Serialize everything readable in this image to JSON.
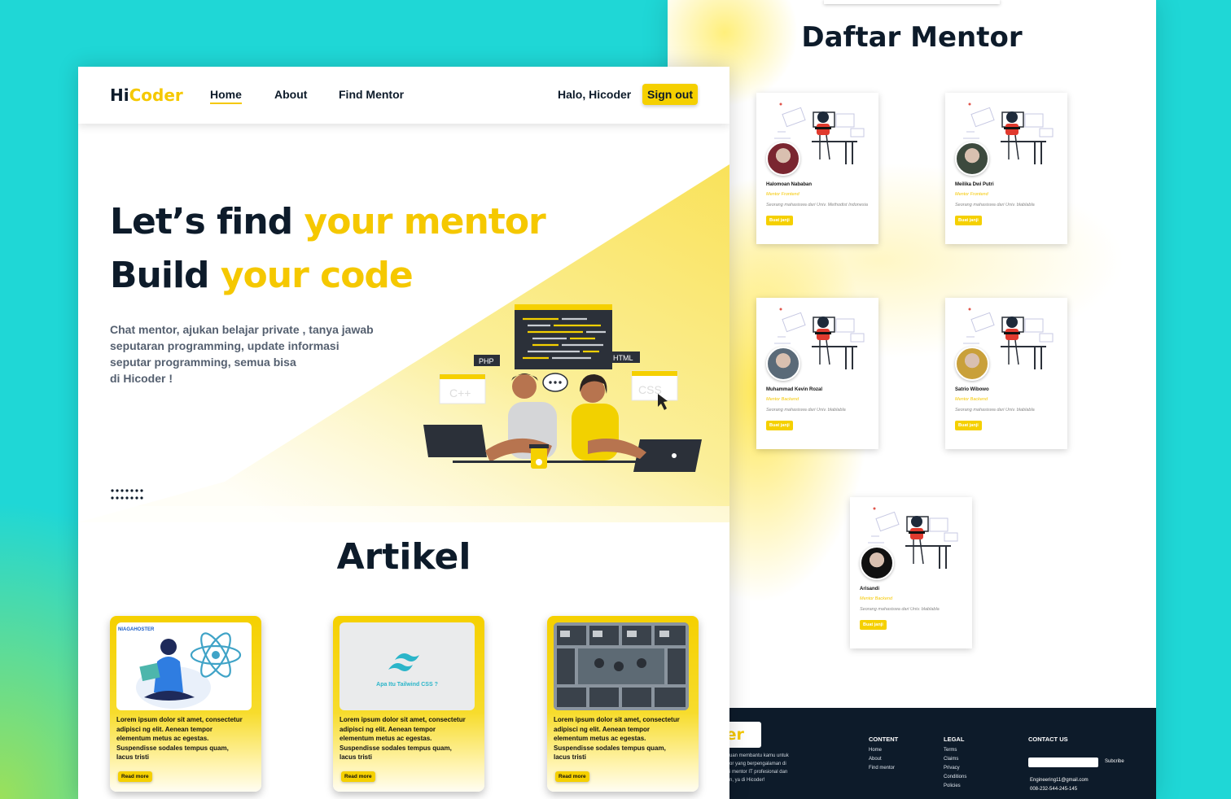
{
  "nav": {
    "logo_part1": "Hi",
    "logo_part2": "Coder",
    "links": [
      "Home",
      "About",
      "Find Mentor"
    ],
    "greeting": "Halo, Hicoder",
    "signout": "Sign out"
  },
  "hero": {
    "line1_dark": "Let’s find",
    "line1_yellow": "your mentor",
    "line2_dark": "Build",
    "line2_yellow": "your code",
    "lead": [
      "Chat mentor, ajukan belajar private , tanya jawab",
      "seputaran programming, update informasi",
      "seputar programming, semua bisa",
      "di Hicoder !"
    ],
    "illustration_tags": [
      "PHP",
      "HTML",
      "C++",
      "CSS"
    ]
  },
  "artikel": {
    "title": "Artikel",
    "cards": [
      {
        "text": [
          "Lorem ipsum dolor sit amet, consectetur",
          "adipisci ng elit. Aenean tempor",
          "elementum metus ac egestas.",
          "Suspendisse sodales tempus quam,",
          " lacus tristi"
        ],
        "button": "Read more",
        "image_caption": "NIAGAHOSTER"
      },
      {
        "text": [
          "Lorem ipsum dolor sit amet, consectetur",
          "adipisci ng elit. Aenean tempor",
          "elementum metus ac egestas.",
          "Suspendisse sodales tempus quam,",
          " lacus tristi"
        ],
        "button": "Read more",
        "image_caption": "Apa Itu Tailwind CSS ?"
      },
      {
        "text": [
          "Lorem ipsum dolor sit amet, consectetur",
          "adipisci ng elit. Aenean tempor",
          "elementum metus ac egestas.",
          "Suspendisse sodales tempus quam,",
          " lacus tristi"
        ],
        "button": "Read more",
        "image_caption": ""
      }
    ]
  },
  "mentors": {
    "title": "Daftar Mentor",
    "list": [
      {
        "name": "Halomoan Nababan",
        "role": "Mentor Frontend",
        "desc": "Seorang mahasiswa dari Univ. Methodist Indonesia",
        "button": "Buat janji"
      },
      {
        "name": "Meilika Dwi Putri",
        "role": "Mentor Frontend",
        "desc": "Seorang mahasiswa dari Univ. blablabla",
        "button": "Buat janji"
      },
      {
        "name": "Muhammad Kevin Rozal",
        "role": "Mentor Backend",
        "desc": "Seorang mahasiswa dari Univ. blablabla",
        "button": "Buat janji"
      },
      {
        "name": "Satrio Wibowo",
        "role": "Mentor Backend",
        "desc": "Seorang mahasiswa dari Univ. blablabla",
        "button": "Buat janji"
      },
      {
        "name": "Arisandi",
        "role": "Mentor Backend",
        "desc": "Seorang mahasiswa dari Univ. blablabla",
        "button": "Buat janji"
      }
    ]
  },
  "footer": {
    "logo_text": "der",
    "about": [
      "uan membantu kamu untuk",
      "or yang berpengalaman di",
      "i mentor IT profesional dan",
      "n, ya di Hicoder!"
    ],
    "content_title": "CONTENT",
    "content_links": [
      "Home",
      "About",
      "Find mentor"
    ],
    "legal_title": "LEGAL",
    "legal_links": [
      "Terms",
      "Claims",
      "Privacy",
      "Conditions",
      "Policies"
    ],
    "contact_title": "CONTACT US",
    "subscribe": "Subcribe",
    "email": "Engineering11@gmail.com",
    "phone": "008-232-544-245-145"
  },
  "colors": {
    "accent": "#f5d000",
    "dark": "#0d1b2a",
    "background": "#1fd7d6"
  }
}
